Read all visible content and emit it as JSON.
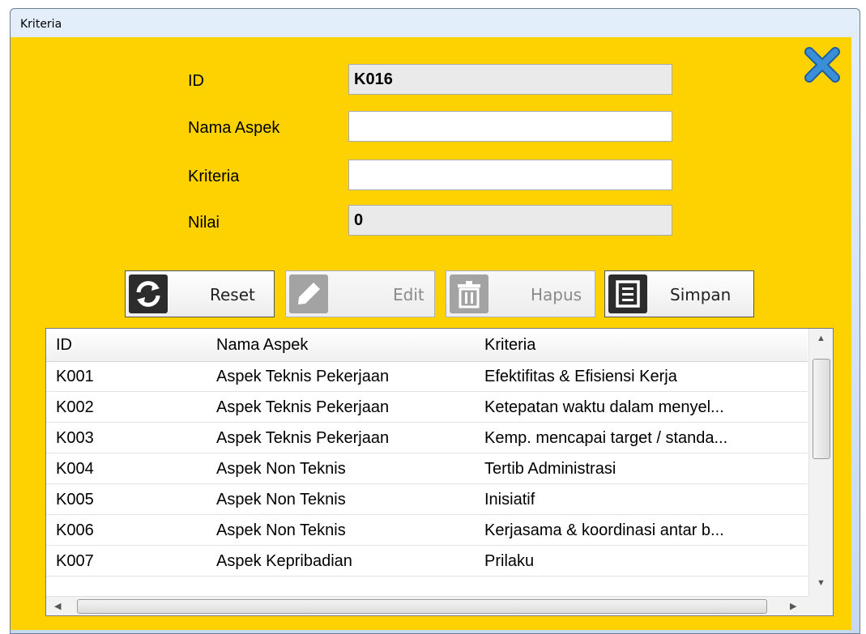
{
  "window": {
    "title": "Kriteria"
  },
  "form": {
    "id_label": "ID",
    "id_value": "K016",
    "nama_aspek_label": "Nama Aspek",
    "nama_aspek_value": "",
    "kriteria_label": "Kriteria",
    "kriteria_value": "",
    "nilai_label": "Nilai",
    "nilai_value": "0"
  },
  "toolbar": {
    "reset_label": "Reset",
    "edit_label": "Edit",
    "hapus_label": "Hapus",
    "simpan_label": "Simpan",
    "reset_icon": "refresh-icon",
    "edit_icon": "pencil-icon",
    "hapus_icon": "trash-icon",
    "simpan_icon": "save-icon"
  },
  "grid": {
    "columns": [
      "ID",
      "Nama Aspek",
      "Kriteria"
    ],
    "rows": [
      [
        "K001",
        "Aspek Teknis Pekerjaan",
        "Efektifitas & Efisiensi Kerja"
      ],
      [
        "K002",
        "Aspek Teknis Pekerjaan",
        "Ketepatan waktu dalam menyel..."
      ],
      [
        "K003",
        "Aspek Teknis Pekerjaan",
        "Kemp. mencapai target / standa..."
      ],
      [
        "K004",
        "Aspek Non Teknis",
        "Tertib Administrasi"
      ],
      [
        "K005",
        "Aspek Non Teknis",
        "Inisiatif"
      ],
      [
        "K006",
        "Aspek Non Teknis",
        "Kerjasama & koordinasi antar b..."
      ],
      [
        "K007",
        "Aspek Kepribadian",
        "Prilaku"
      ]
    ]
  },
  "colors": {
    "background": "#fed200",
    "close_icon": "#3a8fd8"
  }
}
